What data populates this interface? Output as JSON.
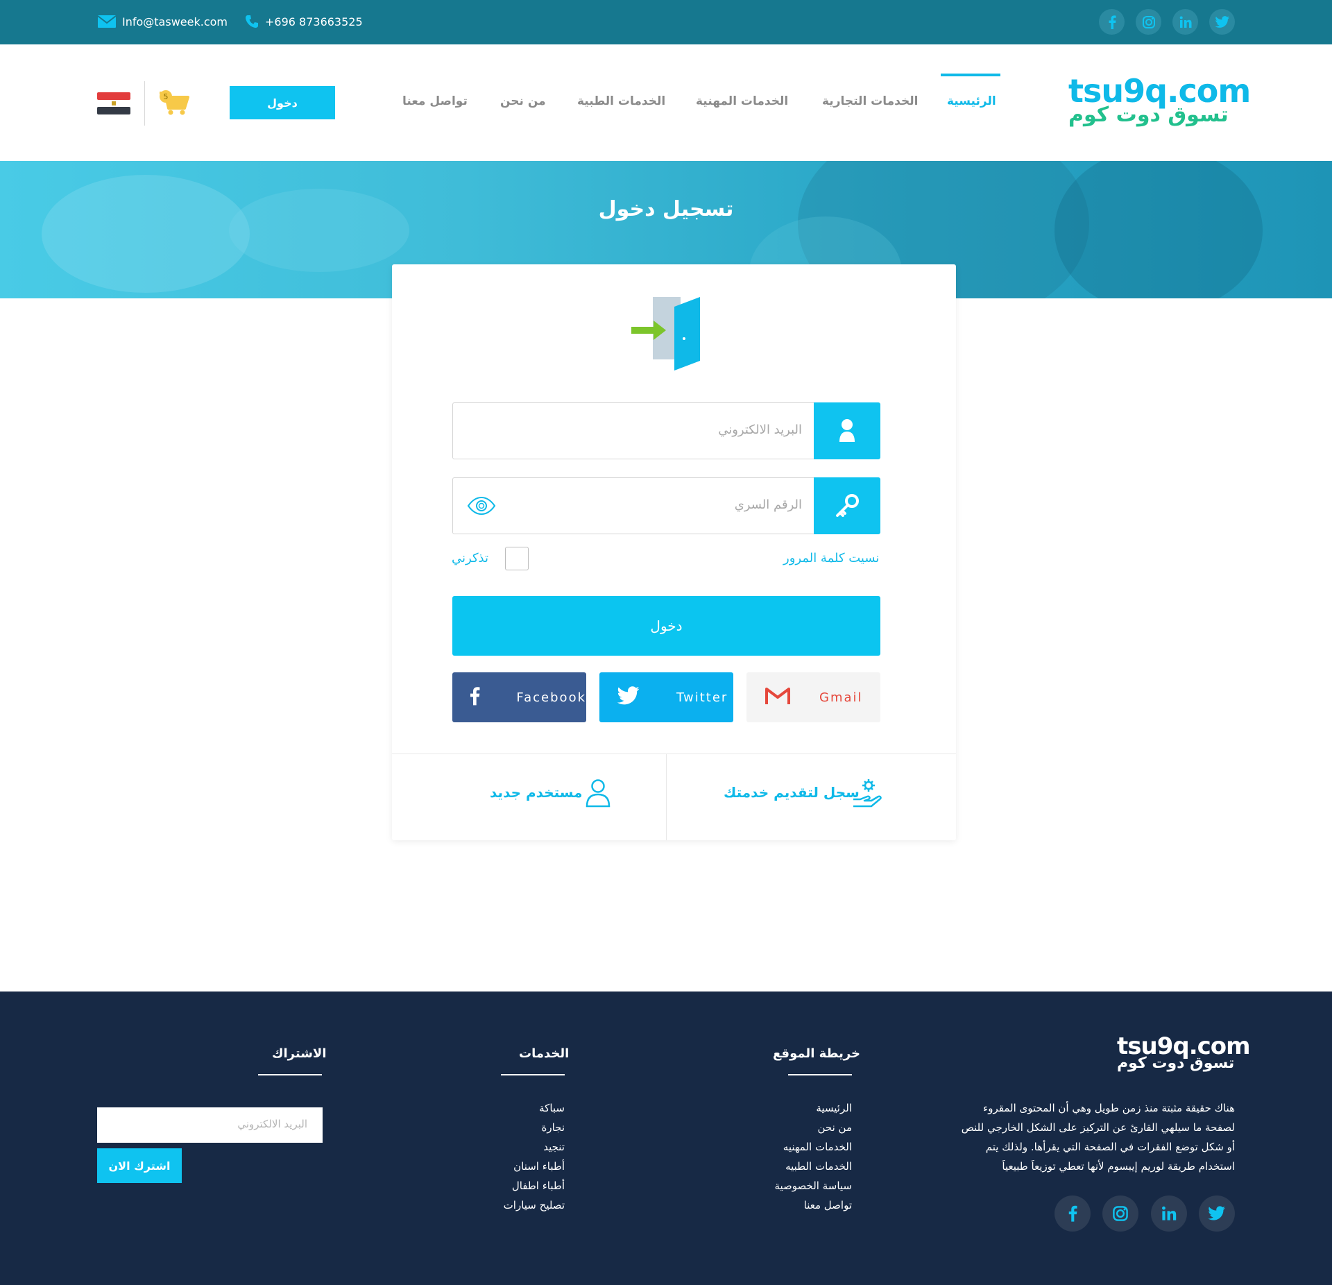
{
  "topbar": {
    "email": "Info@tasweek.com",
    "phone": "+696 873663525",
    "social_icons": [
      "facebook-icon",
      "instagram-icon",
      "linkedin-icon",
      "twitter-icon"
    ]
  },
  "header": {
    "logo_en": "tsu9q.com",
    "logo_ar": "تسوق دوت كوم",
    "nav": [
      "الرئيسية",
      "الخدمات التجارية",
      "الخدمات المهنية",
      "الخدمات الطبية",
      "من نحن",
      "تواصل معنا"
    ],
    "login_button": "دخول",
    "cart_count": "5"
  },
  "banner": {
    "title": "تسجيل دخول"
  },
  "form": {
    "email_placeholder": "البريد الالكتروني",
    "password_placeholder": "الرقم السري",
    "forgot": "نسيت كلمة المرور",
    "remember": "تذكرني",
    "submit": "دخول",
    "facebook": "Facebook",
    "twitter": "Twitter",
    "gmail": "Gmail",
    "register_service": "سجل لتقديم خدمتك",
    "new_user": "مستخدم جديد"
  },
  "footer": {
    "logo_en": "tsu9q.com",
    "logo_ar": "تسوق دوت كوم",
    "about": "هناك حقيقة مثبتة منذ زمن طويل وهي أن المحتوى المقروء لصفحة ما سيلهي القارئ عن التركيز على الشكل الخارجي للنص أو شكل توضع الفقرات في الصفحة التي يقرأها. ولذلك يتم استخدام طريقة لوريم إيبسوم لأنها تعطي توزيعاَ طبيعياَ",
    "sitemap_title": "خريطة الموقع",
    "sitemap": [
      "الرئيسية",
      "من نحن",
      "الخدمات المهنيه",
      "الخدمات الطبيه",
      "سياسة الخصوصية",
      "تواصل معنا"
    ],
    "services_title": "الخدمات",
    "services": [
      "سباكة",
      "نجارة",
      "تنجيد",
      "أطباء اسنان",
      "أطباء اطفال",
      "تصليح سيارات"
    ],
    "subscribe_title": "الاشتراك",
    "subscribe_placeholder": "البريد الالكتروني",
    "subscribe_button": "اشترك الان"
  },
  "colors": {
    "accent": "#0fc3f0",
    "topbar": "#16788f",
    "footer": "#172945",
    "facebook": "#3b5998",
    "twitter": "#1da1f2"
  }
}
